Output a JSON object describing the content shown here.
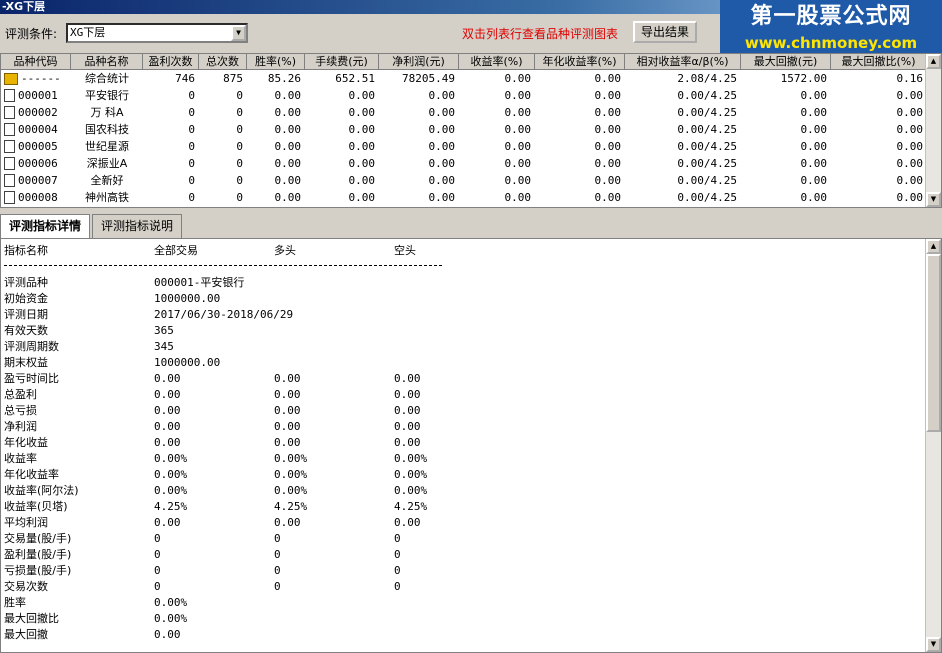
{
  "window": {
    "title": "-XG下层"
  },
  "watermark": {
    "main": "第一股票公式网",
    "sub": "www.chnmoney.com"
  },
  "toolbar": {
    "condition_label": "评测条件:",
    "condition_value": "XG下层",
    "hint": "双击列表行查看品种评测图表",
    "export_label": "导出结果"
  },
  "grid": {
    "columns": [
      "品种代码",
      "品种名称",
      "盈利次数",
      "总次数",
      "胜率(%)",
      "手续费(元)",
      "净利润(元)",
      "收益率(%)",
      "年化收益率(%)",
      "相对收益率α/β(%)",
      "最大回撤(元)",
      "最大回撤比(%)"
    ],
    "rows": [
      {
        "code": "------",
        "name": "综合统计",
        "v": [
          "746",
          "875",
          "85.26",
          "652.51",
          "78205.49",
          "0.00",
          "0.00",
          "2.08/4.25",
          "1572.00",
          "0.16"
        ]
      },
      {
        "code": "000001",
        "name": "平安银行",
        "v": [
          "0",
          "0",
          "0.00",
          "0.00",
          "0.00",
          "0.00",
          "0.00",
          "0.00/4.25",
          "0.00",
          "0.00"
        ]
      },
      {
        "code": "000002",
        "name": "万 科A",
        "v": [
          "0",
          "0",
          "0.00",
          "0.00",
          "0.00",
          "0.00",
          "0.00",
          "0.00/4.25",
          "0.00",
          "0.00"
        ]
      },
      {
        "code": "000004",
        "name": "国农科技",
        "v": [
          "0",
          "0",
          "0.00",
          "0.00",
          "0.00",
          "0.00",
          "0.00",
          "0.00/4.25",
          "0.00",
          "0.00"
        ]
      },
      {
        "code": "000005",
        "name": "世纪星源",
        "v": [
          "0",
          "0",
          "0.00",
          "0.00",
          "0.00",
          "0.00",
          "0.00",
          "0.00/4.25",
          "0.00",
          "0.00"
        ]
      },
      {
        "code": "000006",
        "name": "深振业A",
        "v": [
          "0",
          "0",
          "0.00",
          "0.00",
          "0.00",
          "0.00",
          "0.00",
          "0.00/4.25",
          "0.00",
          "0.00"
        ]
      },
      {
        "code": "000007",
        "name": "全新好",
        "v": [
          "0",
          "0",
          "0.00",
          "0.00",
          "0.00",
          "0.00",
          "0.00",
          "0.00/4.25",
          "0.00",
          "0.00"
        ]
      },
      {
        "code": "000008",
        "name": "神州高铁",
        "v": [
          "0",
          "0",
          "0.00",
          "0.00",
          "0.00",
          "0.00",
          "0.00",
          "0.00/4.25",
          "0.00",
          "0.00"
        ]
      }
    ]
  },
  "tabs": [
    "评测指标详情",
    "评测指标说明"
  ],
  "detail": {
    "header": [
      "指标名称",
      "全部交易",
      "多头",
      "空头"
    ],
    "rows": [
      [
        "评测品种",
        "000001-平安银行",
        "",
        ""
      ],
      [
        "初始资金",
        "1000000.00",
        "",
        ""
      ],
      [
        "评测日期",
        "2017/06/30-2018/06/29",
        "",
        ""
      ],
      [
        "有效天数",
        "365",
        "",
        ""
      ],
      [
        "评测周期数",
        "345",
        "",
        ""
      ],
      [
        "期末权益",
        "1000000.00",
        "",
        ""
      ],
      [
        "盈亏时间比",
        "0.00",
        "0.00",
        "0.00"
      ],
      [
        "总盈利",
        "0.00",
        "0.00",
        "0.00"
      ],
      [
        "总亏损",
        "0.00",
        "0.00",
        "0.00"
      ],
      [
        "净利润",
        "0.00",
        "0.00",
        "0.00"
      ],
      [
        "年化收益",
        "0.00",
        "0.00",
        "0.00"
      ],
      [
        "收益率",
        "0.00%",
        "0.00%",
        "0.00%"
      ],
      [
        "年化收益率",
        "0.00%",
        "0.00%",
        "0.00%"
      ],
      [
        "收益率(阿尔法)",
        "0.00%",
        "0.00%",
        "0.00%"
      ],
      [
        "收益率(贝塔)",
        "4.25%",
        "4.25%",
        "4.25%"
      ],
      [
        "平均利润",
        "0.00",
        "0.00",
        "0.00"
      ],
      [
        "交易量(股/手)",
        "0",
        "0",
        "0"
      ],
      [
        "盈利量(股/手)",
        "0",
        "0",
        "0"
      ],
      [
        "亏损量(股/手)",
        "0",
        "0",
        "0"
      ],
      [
        "交易次数",
        "0",
        "0",
        "0"
      ],
      [
        "胜率",
        "0.00%",
        "",
        ""
      ],
      [
        "最大回撤比",
        "0.00%",
        "",
        ""
      ],
      [
        "最大回撤",
        "0.00",
        "",
        ""
      ]
    ]
  }
}
